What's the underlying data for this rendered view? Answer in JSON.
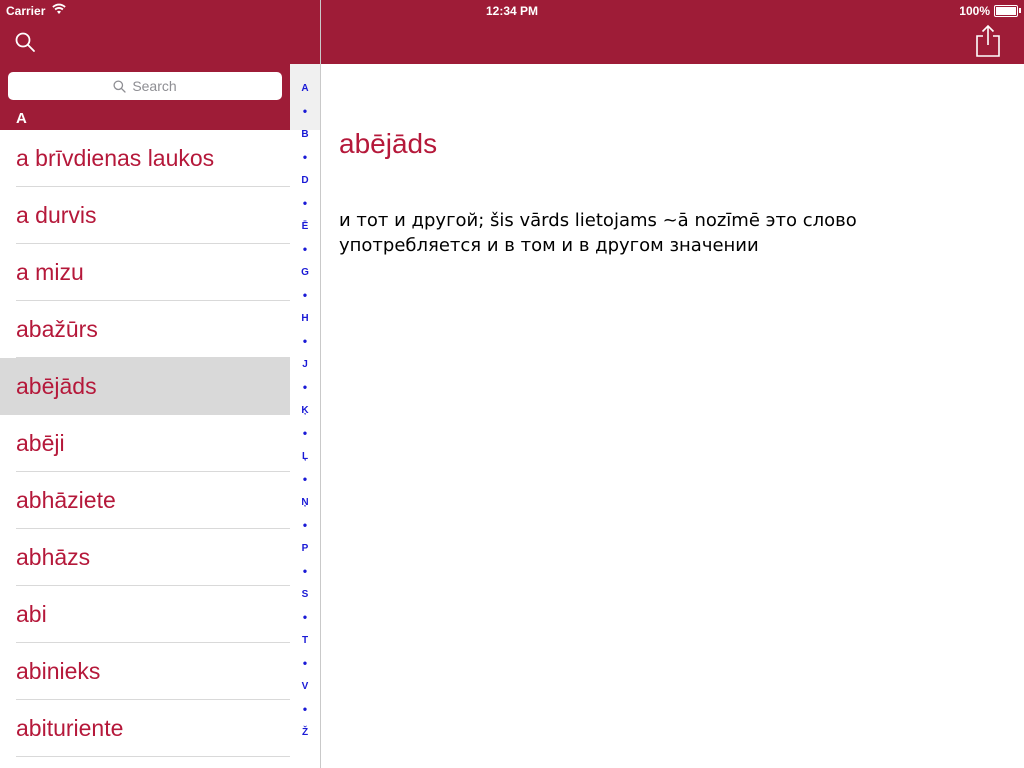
{
  "status_bar": {
    "carrier": "Carrier",
    "time": "12:34 PM",
    "battery": "100%"
  },
  "icons": {
    "top_left": "search-icon",
    "top_right": "share-icon",
    "search_field": "magnifier-icon"
  },
  "search": {
    "placeholder": "Search"
  },
  "section": {
    "header": "A"
  },
  "words": [
    "a brīvdienas laukos",
    "a durvis",
    "a mizu",
    "abažūrs",
    "abējāds",
    "abēji",
    "abhāziete",
    "abhāzs",
    "abi",
    "abinieks",
    "abituriente"
  ],
  "selected_word": "abējāds",
  "index_letters": [
    "A",
    "B",
    "D",
    "Ē",
    "G",
    "H",
    "J",
    "Ķ",
    "Ļ",
    "Ņ",
    "P",
    "S",
    "T",
    "V",
    "Ž"
  ],
  "index_separator": "•",
  "detail": {
    "title": "abējāds",
    "definition": " и тот и другой; šis vārds lietojams ~ā nozīmē это слово употребляется и в том и в другом значении"
  },
  "colors": {
    "bar": "#9e1c37",
    "accent_text": "#b5183a",
    "index_text": "#1a1ad6",
    "selection": "#d9d9d9"
  }
}
